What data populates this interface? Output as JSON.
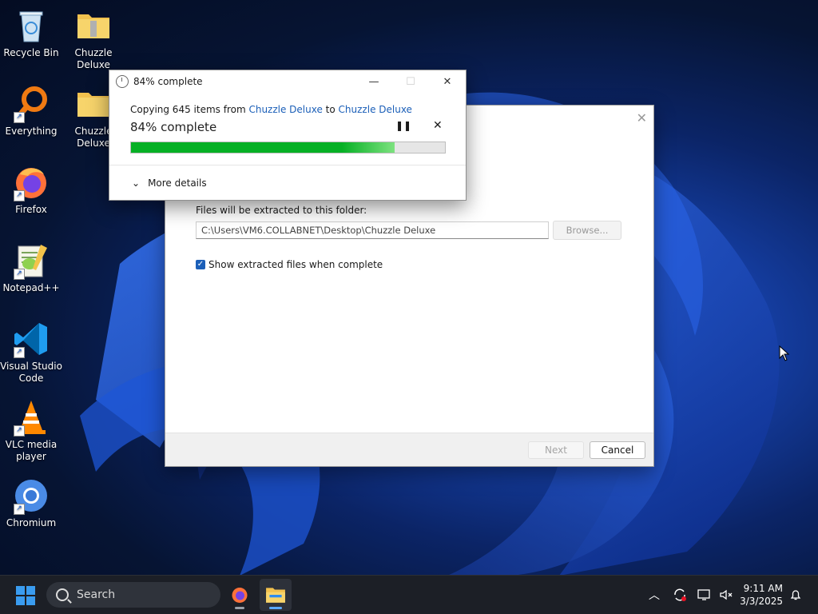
{
  "desktop": {
    "icons": [
      {
        "label": "Recycle Bin",
        "icon": "recycle-bin-icon"
      },
      {
        "label": "Chuzzle Deluxe",
        "icon": "zip-folder-icon"
      },
      {
        "label": "Everything",
        "icon": "everything-search-icon"
      },
      {
        "label": "Chuzzle Deluxe",
        "icon": "folder-icon"
      },
      {
        "label": "Firefox",
        "icon": "firefox-icon"
      },
      {
        "label": "Notepad++",
        "icon": "notepadpp-icon"
      },
      {
        "label": "Visual Studio Code",
        "icon": "vscode-icon"
      },
      {
        "label": "VLC media player",
        "icon": "vlc-icon"
      },
      {
        "label": "Chromium",
        "icon": "chromium-icon"
      }
    ]
  },
  "copy_dialog": {
    "title": "84% complete",
    "copy_prefix": "Copying 645 items from ",
    "source": "Chuzzle Deluxe",
    "to_word": " to ",
    "destination": "Chuzzle Deluxe",
    "percent_text": "84% complete",
    "progress": 0.84,
    "more_details": "More details",
    "progress_color": "#06b025"
  },
  "wizard": {
    "folder_label": "Files will be extracted to this folder:",
    "path_value": "C:\\Users\\VM6.COLLABNET\\Desktop\\Chuzzle Deluxe",
    "browse_label": "Browse...",
    "show_files_label": "Show extracted files when complete",
    "show_files_checked": true,
    "next_label": "Next",
    "cancel_label": "Cancel"
  },
  "taskbar": {
    "search_placeholder": "Search",
    "time": "9:11 AM",
    "date": "3/3/2025",
    "accent": "#3a9cf0"
  }
}
